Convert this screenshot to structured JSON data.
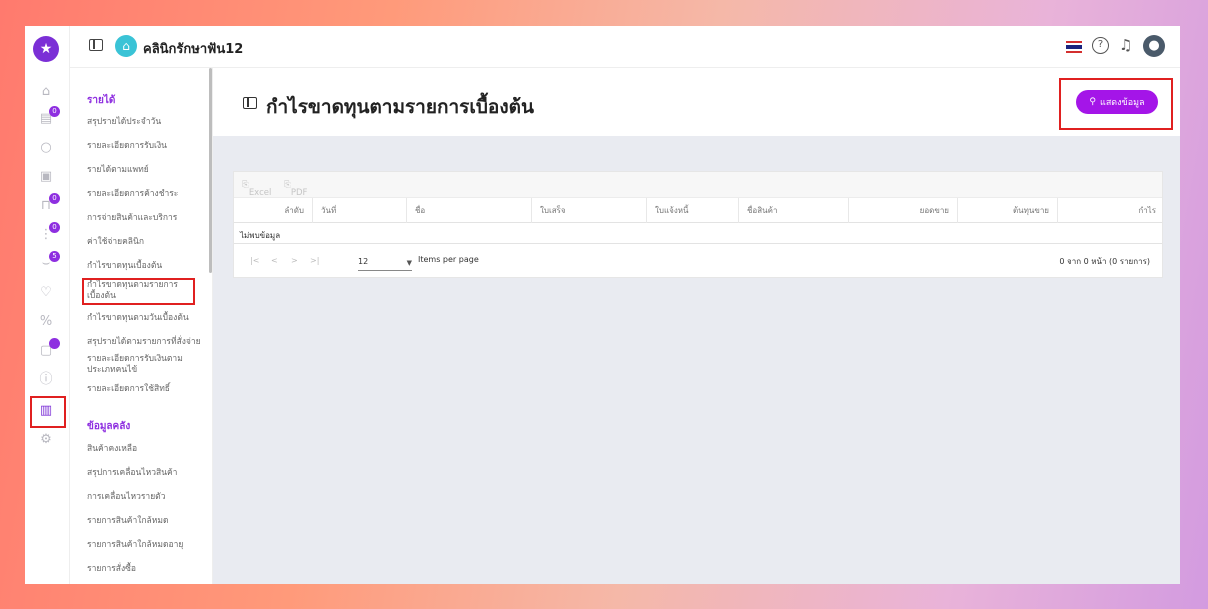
{
  "header": {
    "clinic_name": "คลินิกรักษาฟัน12"
  },
  "rail": {
    "badges": [
      "0",
      "0",
      "0",
      "5",
      ""
    ]
  },
  "sidebar": {
    "section_income": "รายได้",
    "income_items": [
      "สรุปรายได้ประจำวัน",
      "รายละเอียดการรับเงิน",
      "รายได้ตามแพทย์",
      "รายละเอียดการค้างชำระ",
      "การจ่ายสินค้าและบริการ",
      "ค่าใช้จ่ายคลินิก",
      "กำไรขาดทุนเบื้องต้น",
      "กำไรขาดทุนตามรายการเบื้องต้น",
      "กำไรขาดทุนตามวันเบื้องต้น",
      "สรุปรายได้ตามรายการที่สั่งจ่าย",
      "รายละเอียดการรับเงินตามประเภทคนไข้",
      "รายละเอียดการใช้สิทธิ์"
    ],
    "section_inventory": "ข้อมูลคลัง",
    "inventory_items": [
      "สินค้าคงเหลือ",
      "สรุปการเคลื่อนไหวสินค้า",
      "การเคลื่อนไหวรายตัว",
      "รายการสินค้าใกล้หมด",
      "รายการสินค้าใกล้หมดอายุ",
      "รายการสั่งซื้อ"
    ]
  },
  "main": {
    "title": "กำไรขาดทุนตามรายการเบื้องต้น",
    "show_button": "แสดงข้อมูล",
    "export_excel": "Excel",
    "export_pdf": "PDF",
    "columns": [
      "ลำดับ",
      "วันที่",
      "ชื่อ",
      "ใบเสร็จ",
      "ใบแจ้งหนี้",
      "ชื่อสินค้า",
      "ยอดขาย",
      "ต้นทุนขาย",
      "กำไร"
    ],
    "no_data": "ไม่พบข้อมูล",
    "per_page_value": "12",
    "items_per_page": "Items per page",
    "page_count": "0 จาก 0 หน้า (0 รายการ)"
  }
}
